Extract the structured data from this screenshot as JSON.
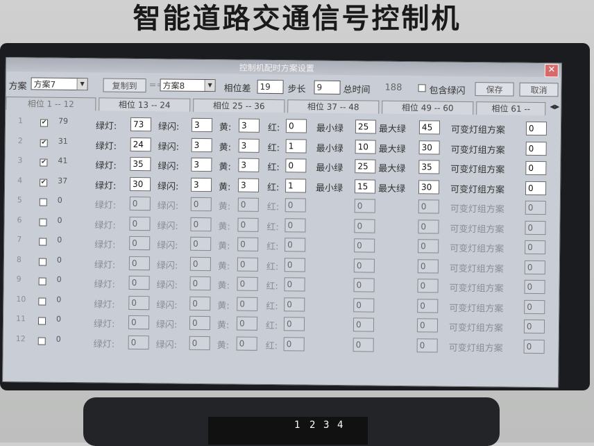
{
  "device_title": "智能道路交通信号控制机",
  "window": {
    "title": "控制机配时方案设置",
    "close_glyph": "✕"
  },
  "toolbar": {
    "scheme_label": "方案",
    "scheme_value": "方案7",
    "copy_label": "复制到",
    "copy_arrow": "==",
    "target_value": "方案8",
    "phase_diff_label": "相位差",
    "phase_diff_value": "19",
    "step_label": "步长",
    "step_value": "9",
    "total_time_label": "总时间",
    "total_time_value": "188",
    "include_flash_label": "包含绿闪",
    "save_label": "保存",
    "cancel_label": "取消"
  },
  "tabs": [
    "相位 1 -- 12",
    "相位 13 -- 24",
    "相位 25 -- 36",
    "相位 37 -- 48",
    "相位 49 -- 60",
    "相位 61 --"
  ],
  "labels": {
    "green": "绿灯",
    "flash": "绿闪",
    "yellow": "黄",
    "red": "红",
    "min_green": "最小绿",
    "max_green": "最大绿",
    "var_group": "可变灯组方案"
  },
  "rows": [
    {
      "num": "1",
      "checked": true,
      "value": "79",
      "green": "73",
      "flash": "3",
      "yellow": "3",
      "red": "0",
      "min": "25",
      "max": "45",
      "var": "0"
    },
    {
      "num": "2",
      "checked": true,
      "value": "31",
      "green": "24",
      "flash": "3",
      "yellow": "3",
      "red": "1",
      "min": "10",
      "max": "30",
      "var": "0"
    },
    {
      "num": "3",
      "checked": true,
      "value": "41",
      "green": "35",
      "flash": "3",
      "yellow": "3",
      "red": "0",
      "min": "25",
      "max": "35",
      "var": "0"
    },
    {
      "num": "4",
      "checked": true,
      "value": "37",
      "green": "30",
      "flash": "3",
      "yellow": "3",
      "red": "1",
      "min": "15",
      "max": "30",
      "var": "0"
    },
    {
      "num": "5",
      "checked": false,
      "value": "0",
      "green": "0",
      "flash": "0",
      "yellow": "0",
      "red": "0",
      "min": "0",
      "max": "0",
      "var": "0"
    },
    {
      "num": "6",
      "checked": false,
      "value": "0",
      "green": "0",
      "flash": "0",
      "yellow": "0",
      "red": "0",
      "min": "0",
      "max": "0",
      "var": "0"
    },
    {
      "num": "7",
      "checked": false,
      "value": "0",
      "green": "0",
      "flash": "0",
      "yellow": "0",
      "red": "0",
      "min": "0",
      "max": "0",
      "var": "0"
    },
    {
      "num": "8",
      "checked": false,
      "value": "0",
      "green": "0",
      "flash": "0",
      "yellow": "0",
      "red": "0",
      "min": "0",
      "max": "0",
      "var": "0"
    },
    {
      "num": "9",
      "checked": false,
      "value": "0",
      "green": "0",
      "flash": "0",
      "yellow": "0",
      "red": "0",
      "min": "0",
      "max": "0",
      "var": "0"
    },
    {
      "num": "10",
      "checked": false,
      "value": "0",
      "green": "0",
      "flash": "0",
      "yellow": "0",
      "red": "0",
      "min": "0",
      "max": "0",
      "var": "0"
    },
    {
      "num": "11",
      "checked": false,
      "value": "0",
      "green": "0",
      "flash": "0",
      "yellow": "0",
      "red": "0",
      "min": "0",
      "max": "0",
      "var": "0"
    },
    {
      "num": "12",
      "checked": false,
      "value": "0",
      "green": "0",
      "flash": "0",
      "yellow": "0",
      "red": "0",
      "min": "0",
      "max": "0",
      "var": "0"
    }
  ],
  "keypad": {
    "keys": [
      "1",
      "2",
      "3",
      "4"
    ]
  }
}
